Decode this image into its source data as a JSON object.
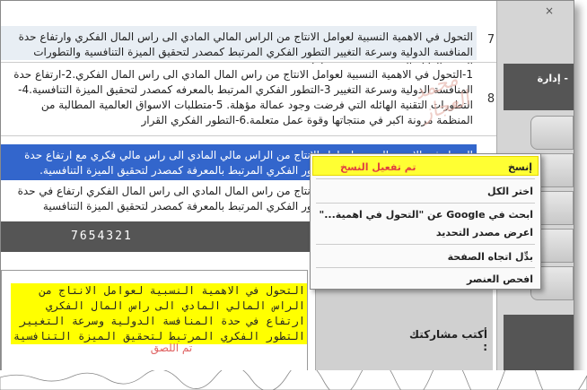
{
  "window": {
    "close_glyph": "×"
  },
  "rows": [
    {
      "num": "7",
      "text": "التحول في الاهمية النسبية لعوامل الانتاج من الراس المالي المادي الى راس المال الفكري وارتفاع حدة المنافسة الدولية وسرعة التغيير التطور الفكري المرتبط كمصدر لتحقيق الميزة التنافسية والتطورات التقنية الهائلة التي فرضت وجود عاملة",
      "selected": false
    },
    {
      "num": "8",
      "text": "1-التحول في الاهمية النسبية لعوامل الانتاج من راس المال المادي الى راس المال الفكري.2-ارتفاع حدة المنافسة الدولية وسرعة التغيير 3-التطور الفكري المرتبط بالمعرفه كمصدر لتحقيق الميزة التنافسية.4-التطورات التقنية الهائله التي فرضت وجود عمالة مؤهلة. 5-متطلبات الاسواق العالمية المطالبة من المنظمة مرونة اكبر في منتجاتها وقوة عمل متعلمة.6-التطور الفكري القرار",
      "selected": false
    },
    {
      "num": "",
      "text": "التحول في الاهمية النسبية لعوامل الانتاج من الراس مالي المادي الى راس مالي فكري مع ارتفاع حدة المنافسة الدولية وسرعة التغيير التطور الفكري المرتبط بالمعرفة كمصدر لتحقيق الميزة التنافسية.",
      "selected": true
    },
    {
      "num": "",
      "text": "التحول في الاهمية النسبية لعوامل الانتاج من راس المال المادي الى راس المال الفكري ارتفاع في حدة المنافسة الدولية وسرعة التغيير التطور الفكري المرتبط بالمعرفة كمصدر لتحقيق الميزة التنافسية",
      "selected": false
    }
  ],
  "code_bar": {
    "text": "7654321"
  },
  "signature": {
    "text": "محمد العجاز"
  },
  "paste_box": {
    "text": "التحول في الاهمية النسبية لعوامل الانتاج من الراس المالي المادي الى راس المال الفكري ارتفاع في حدة المنافسة الدولية وسرعة التغيير التطور الفكري المرتبط لتحقيق الميزة التنافسية",
    "pasted_label": "تم اللصق"
  },
  "share": {
    "label": "أكتب مشاركتك :"
  },
  "right_panel": {
    "tab_label": "- إدارة"
  },
  "context_menu": {
    "copied_note": "تم تفعيل النسخ",
    "items": [
      {
        "label": "إنسخ",
        "highlight": true
      },
      {
        "label": "اختر الكل",
        "highlight": false
      },
      {
        "label": "ابحث في Google عن \"التحول في اهمية...\"",
        "highlight": false
      },
      {
        "label": "اعرض مصدر التحديد",
        "highlight": false
      },
      {
        "label": "بدِّل اتجاه الصفحة",
        "highlight": false
      },
      {
        "label": "افحص العنصر",
        "highlight": false
      }
    ]
  },
  "colors": {
    "highlight": "#ffff33",
    "selection": "#3366cc",
    "copied_note": "#e04040",
    "pasted": "#e06666"
  }
}
